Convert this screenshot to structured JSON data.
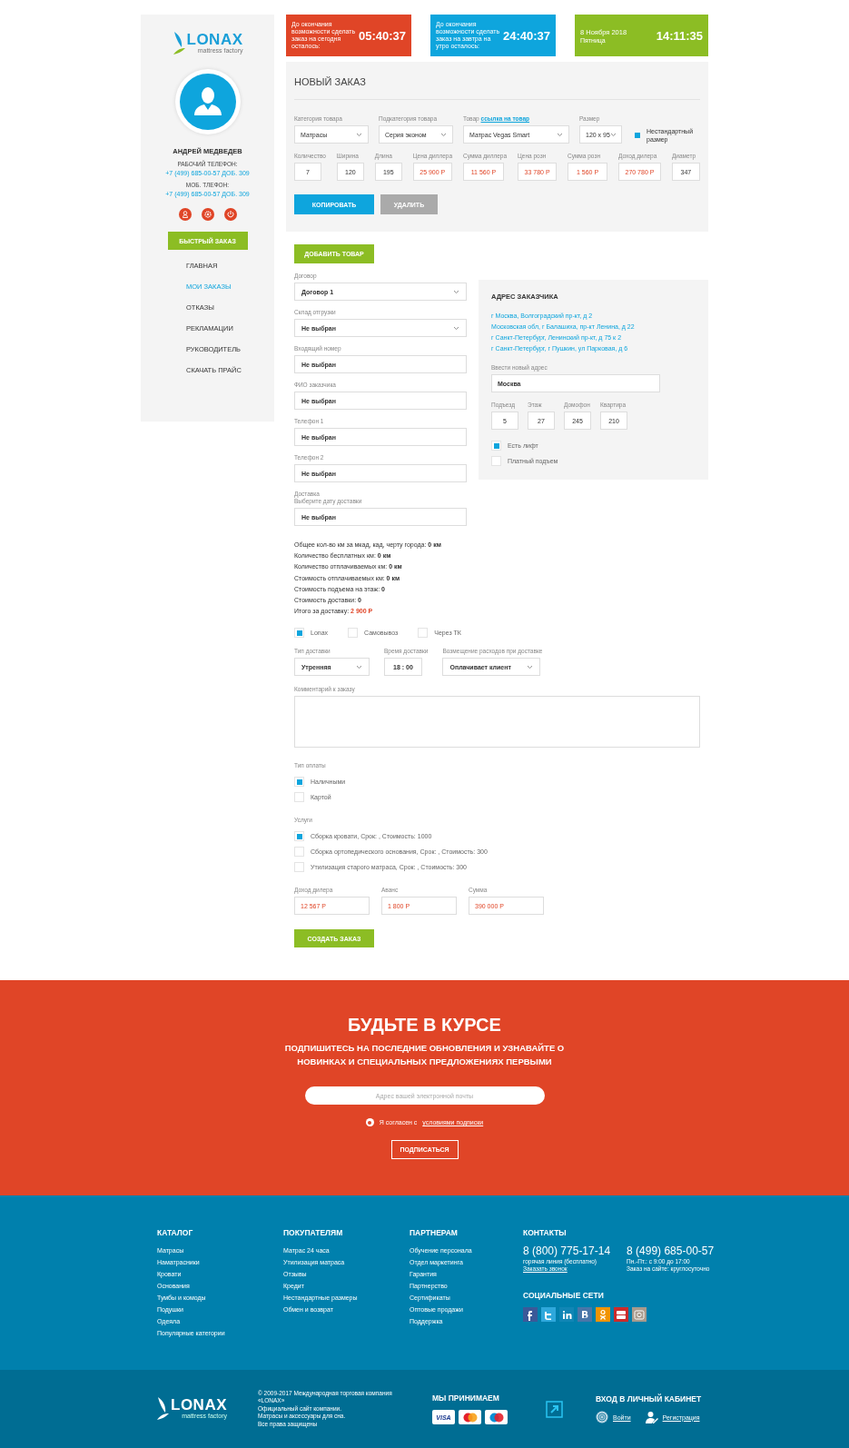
{
  "sidebar": {
    "logo": {
      "name": "LONAX",
      "tagline": "mattress factory"
    },
    "user": {
      "name": "АНДРЕЙ МЕДВЕДЕВ",
      "phones": [
        {
          "label": "РАБОЧИЙ ТЕЛЕФОН:",
          "number": "+7 (499) 685-00-57 ДОБ. 309"
        },
        {
          "label": "МОБ. ТЛЕФОН:",
          "number": "+7 (499) 685-00-57 ДОБ. 309"
        }
      ]
    },
    "actions": [
      {
        "kind": "user"
      },
      {
        "kind": "settings"
      },
      {
        "kind": "power"
      }
    ],
    "quick_order": "БЫСТРЫЙ ЗАКАЗ",
    "nav": [
      {
        "label": "ГЛАВНАЯ",
        "selected": false
      },
      {
        "label": "МОИ ЗАКАЗЫ",
        "selected": true
      },
      {
        "label": "ОТКАЗЫ",
        "selected": false
      },
      {
        "label": "РЕКЛАМАЦИИ",
        "selected": false
      },
      {
        "label": "РУКОВОДИТЕЛЬ",
        "selected": false
      },
      {
        "label": "СКАЧАТЬ ПРАЙС",
        "selected": false
      }
    ]
  },
  "timers": [
    {
      "kind": "countdown",
      "color": "#e04527",
      "text": "До окончания возможности сделать заказ на сегодня осталось:",
      "time": "05:40:37"
    },
    {
      "kind": "countdown",
      "color": "#0ea5dd",
      "text": "До окончания возможности сделать заказ на завтра на утро осталось:",
      "time": "24:40:37"
    },
    {
      "kind": "date",
      "color": "#8cbd24",
      "date": "8 Ноября 2018",
      "weekday": "Пятница",
      "time": "14:11:35"
    }
  ],
  "order": {
    "title": "НОВЫЙ ЗАКАЗ",
    "selects": [
      {
        "label": "Категория товара",
        "value": "Матрасы"
      },
      {
        "label": "Подкатегория товара",
        "value": "Серия эконом"
      },
      {
        "label": "Товар",
        "link": "ссылка на товар",
        "value": "Матрас Vegas Smart"
      },
      {
        "label": "Размер",
        "value": "120 x 95"
      }
    ],
    "nonstandard": {
      "label": "Нестандартный размер",
      "checked": true
    },
    "fields": [
      {
        "label": "Количество",
        "value": "7",
        "accent": false
      },
      {
        "label": "Ширина",
        "value": "120",
        "accent": false
      },
      {
        "label": "Длина",
        "value": "195",
        "accent": false
      },
      {
        "label": "Цена диллера",
        "value": "25 900 Р",
        "accent": true
      },
      {
        "label": "Сумма диллера",
        "value": "11 560 Р",
        "accent": true
      },
      {
        "label": "Цена розн",
        "value": "33 780 Р",
        "accent": true
      },
      {
        "label": "Сумма розн",
        "value": "1 560 Р",
        "accent": true
      },
      {
        "label": "Доход дилера",
        "value": "270 780 Р",
        "accent": true
      },
      {
        "label": "Диаметр",
        "value": "347",
        "accent": false
      }
    ],
    "buttons": [
      {
        "label": "КОПИРОВАТЬ",
        "kind": "primary"
      },
      {
        "label": "УДАЛИТЬ",
        "kind": "secondary"
      }
    ]
  },
  "add_product": "ДОБАВИТЬ ТОВАР",
  "details": [
    {
      "label": "Договор",
      "value": "Договор 1",
      "kind": "select"
    },
    {
      "label": "Склад отгрузки",
      "value": "Не выбран",
      "kind": "select"
    },
    {
      "label": "Входящий номер",
      "value": "Не выбран",
      "kind": "input"
    },
    {
      "label": "ФИО заказчика",
      "value": "Не выбран",
      "kind": "input"
    },
    {
      "label": "Телефон 1",
      "value": "Не выбран",
      "kind": "input"
    },
    {
      "label": "Телефон 2",
      "value": "Не выбран",
      "kind": "input"
    },
    {
      "label": "Доставка",
      "hint": "Выберите дату доставки",
      "value": "Не выбран",
      "kind": "input"
    }
  ],
  "summary": [
    {
      "label": "Общее кол-во км за мкад, кад, черту города:",
      "value": "0 км",
      "accent": false
    },
    {
      "label": "Количество бесплатных км:",
      "value": "0 км",
      "accent": false
    },
    {
      "label": "Количество отплачиваемых км:",
      "value": "0 км",
      "accent": false
    },
    {
      "label": "Стоимость отплачиваемых км:",
      "value": "0 км",
      "accent": false
    },
    {
      "label": "Стоимость подъема на этаж:",
      "value": "0",
      "accent": false
    },
    {
      "label": "Стоимость доставки:",
      "value": "0",
      "accent": false
    },
    {
      "label": "Итого за доставку:",
      "value": "2 900 Р",
      "accent": true
    }
  ],
  "address": {
    "title": "АДРЕС ЗАКАЗЧИКА",
    "saved": [
      "г Москва, Волгоградский пр-кт, д 2",
      "Московская обл, г Балашиха, пр-кт Ленина, д 22",
      "г Санкт-Петербург, Ленинский пр-кт, д 75 к 2",
      "г Санкт-Петербург, г Пушкин, ул Парковая, д 6"
    ],
    "new_label": "Ввести новый адрес",
    "new_value": "Москва",
    "fields": [
      {
        "label": "Подъезд",
        "value": "5"
      },
      {
        "label": "Этаж",
        "value": "27"
      },
      {
        "label": "Домофон",
        "value": "245"
      },
      {
        "label": "Квартира",
        "value": "210"
      }
    ],
    "options": [
      {
        "label": "Есть лифт",
        "checked": true
      },
      {
        "label": "Платный подъем",
        "checked": false
      }
    ]
  },
  "delivery_methods": [
    {
      "label": "Lonax",
      "checked": true
    },
    {
      "label": "Самовывоз",
      "checked": false
    },
    {
      "label": "Через ТК",
      "checked": false
    }
  ],
  "delivery_options": [
    {
      "label": "Тип доставки",
      "value": "Утренняя",
      "kind": "select"
    },
    {
      "label": "Время доставки",
      "value": "18 : 00",
      "kind": "time"
    },
    {
      "label": "Возмещение расходов при доставке",
      "value": "Оплачивает клиент",
      "kind": "select"
    }
  ],
  "comment": {
    "label": "Комментарий к заказу"
  },
  "payment": {
    "label": "Тип оплаты",
    "options": [
      {
        "label": "Наличными",
        "checked": true
      },
      {
        "label": "Картой",
        "checked": false
      }
    ]
  },
  "services": {
    "label": "Услуги",
    "options": [
      {
        "label": "Сборка кровати, Срок: , Стоимость: 1000",
        "checked": true
      },
      {
        "label": "Сборка ортопедического основания, Срок: , Стоимость: 300",
        "checked": false
      },
      {
        "label": "Утилизация старого матраса, Срок: , Стоимость: 300",
        "checked": false
      }
    ]
  },
  "totals": [
    {
      "label": "Доход дилера",
      "value": "12 567 Р"
    },
    {
      "label": "Аванс",
      "value": "1 800 Р"
    },
    {
      "label": "Сумма",
      "value": "390 000 Р"
    }
  ],
  "create_order": "СОЗДАТЬ ЗАКАЗ",
  "subscribe": {
    "title": "БУДЬТЕ В КУРСЕ",
    "subtitle": "ПОДПИШИТЕСЬ НА ПОСЛЕДНИЕ ОБНОВЛЕНИЯ И УЗНАВАЙТЕ О НОВИНКАХ И СПЕЦИАЛЬНЫХ ПРЕДЛОЖЕНИЯХ ПЕРВЫМИ",
    "placeholder": "Адрес вашей электронной почты",
    "consent": "Я согласен с",
    "consent_link": "условиями подписки",
    "consent_checked": true,
    "button": "ПОДПИСАТЬСЯ"
  },
  "footer": {
    "columns": [
      {
        "title": "КАТАЛОГ",
        "links": [
          "Матрасы",
          "Наматрасники",
          "Кровати",
          "Основания",
          "Тумбы и комоды",
          "Подушки",
          "Одеяла",
          "Популярные категории"
        ]
      },
      {
        "title": "ПОКУПАТЕЛЯМ",
        "links": [
          "Матрас 24 часа",
          "Утилизация матраса",
          "Отзывы",
          "Кредит",
          "Нестандартные размеры",
          "Обмен и возврат"
        ]
      },
      {
        "title": "ПАРТНЕРАМ",
        "links": [
          "Обучение персонала",
          "Отдел маркетинга",
          "Гарантия",
          "Партнерство",
          "Сертификаты",
          "Оптовые продажи",
          "Поддержка"
        ]
      }
    ],
    "contacts": {
      "title": "КОНТАКТЫ",
      "phones": [
        {
          "number": "8 (800) 775-17-14",
          "notes": [
            "горячая линия (бесплатно)"
          ],
          "link": "Заказать звонок"
        },
        {
          "number": "8 (499) 685-00-57",
          "notes": [
            "Пн.-Пт.: с 9:00 до 17:00",
            "Заказ на сайте: круглосуточно"
          ]
        }
      ]
    },
    "social": {
      "title": "СОЦИАЛЬНЫЕ СЕТИ",
      "networks": [
        {
          "kind": "f",
          "color": "#3b5998"
        },
        {
          "kind": "bird",
          "color": "#2fa8dc"
        },
        {
          "kind": "in",
          "color": "#1186b5"
        },
        {
          "kind": "b",
          "color": "#4a76a8"
        },
        {
          "kind": "ok",
          "color": "#f29400"
        },
        {
          "kind": "tube",
          "color": "#cc2b2b"
        },
        {
          "kind": "camera",
          "color": "#a89a8c"
        }
      ]
    }
  },
  "bottom": {
    "logo": {
      "name": "LONAX",
      "tagline": "mattress factory"
    },
    "copyright": [
      "© 2009-2017 Международная торговая компания «LONAX»",
      "Официальный сайт компании.",
      "Матрасы и аксессуары для сна.",
      "Все права защищены"
    ],
    "payments_title": "МЫ ПРИНИМАЕМ",
    "cards": [
      {
        "kind": "visa",
        "label": "VISA"
      },
      {
        "kind": "mastercard"
      },
      {
        "kind": "maestro"
      }
    ],
    "account_title": "ВХОД В ЛИЧНЫЙ КАБИНЕТ",
    "account_links": [
      {
        "kind": "login",
        "label": "Войти"
      },
      {
        "kind": "register",
        "label": "Регистрация"
      }
    ]
  }
}
